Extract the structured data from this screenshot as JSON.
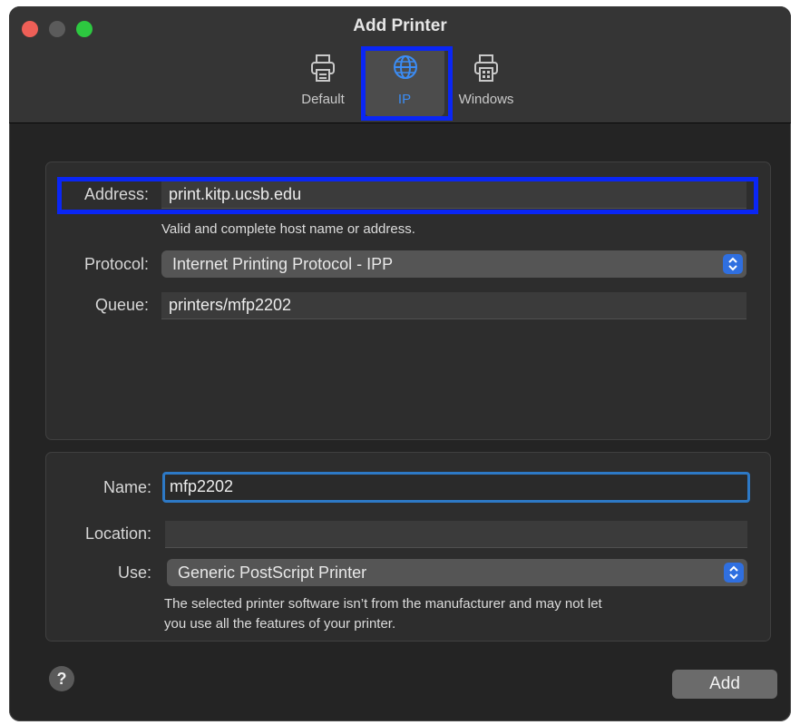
{
  "window": {
    "title": "Add Printer"
  },
  "toolbar": {
    "tabs": [
      {
        "label": "Default",
        "icon": "printer-icon"
      },
      {
        "label": "IP",
        "icon": "globe-icon"
      },
      {
        "label": "Windows",
        "icon": "windows-printer-icon"
      }
    ],
    "selected": "IP"
  },
  "connection": {
    "address_label": "Address:",
    "address_value": "print.kitp.ucsb.edu",
    "address_hint": "Valid and complete host name or address.",
    "protocol_label": "Protocol:",
    "protocol_value": "Internet Printing Protocol - IPP",
    "queue_label": "Queue:",
    "queue_value": "printers/mfp2202"
  },
  "printer": {
    "name_label": "Name:",
    "name_value": "mfp2202",
    "location_label": "Location:",
    "location_value": "",
    "use_label": "Use:",
    "use_value": "Generic PostScript Printer",
    "use_note_line1": "The selected printer software isn’t from the manufacturer and may not let",
    "use_note_line2": "you use all the features of your printer."
  },
  "footer": {
    "help_label": "?",
    "add_label": "Add"
  },
  "colors": {
    "accent": "#3b8cf4",
    "annotation": "#0a26f5",
    "close": "#ee5f57",
    "zoom": "#2dc840"
  }
}
